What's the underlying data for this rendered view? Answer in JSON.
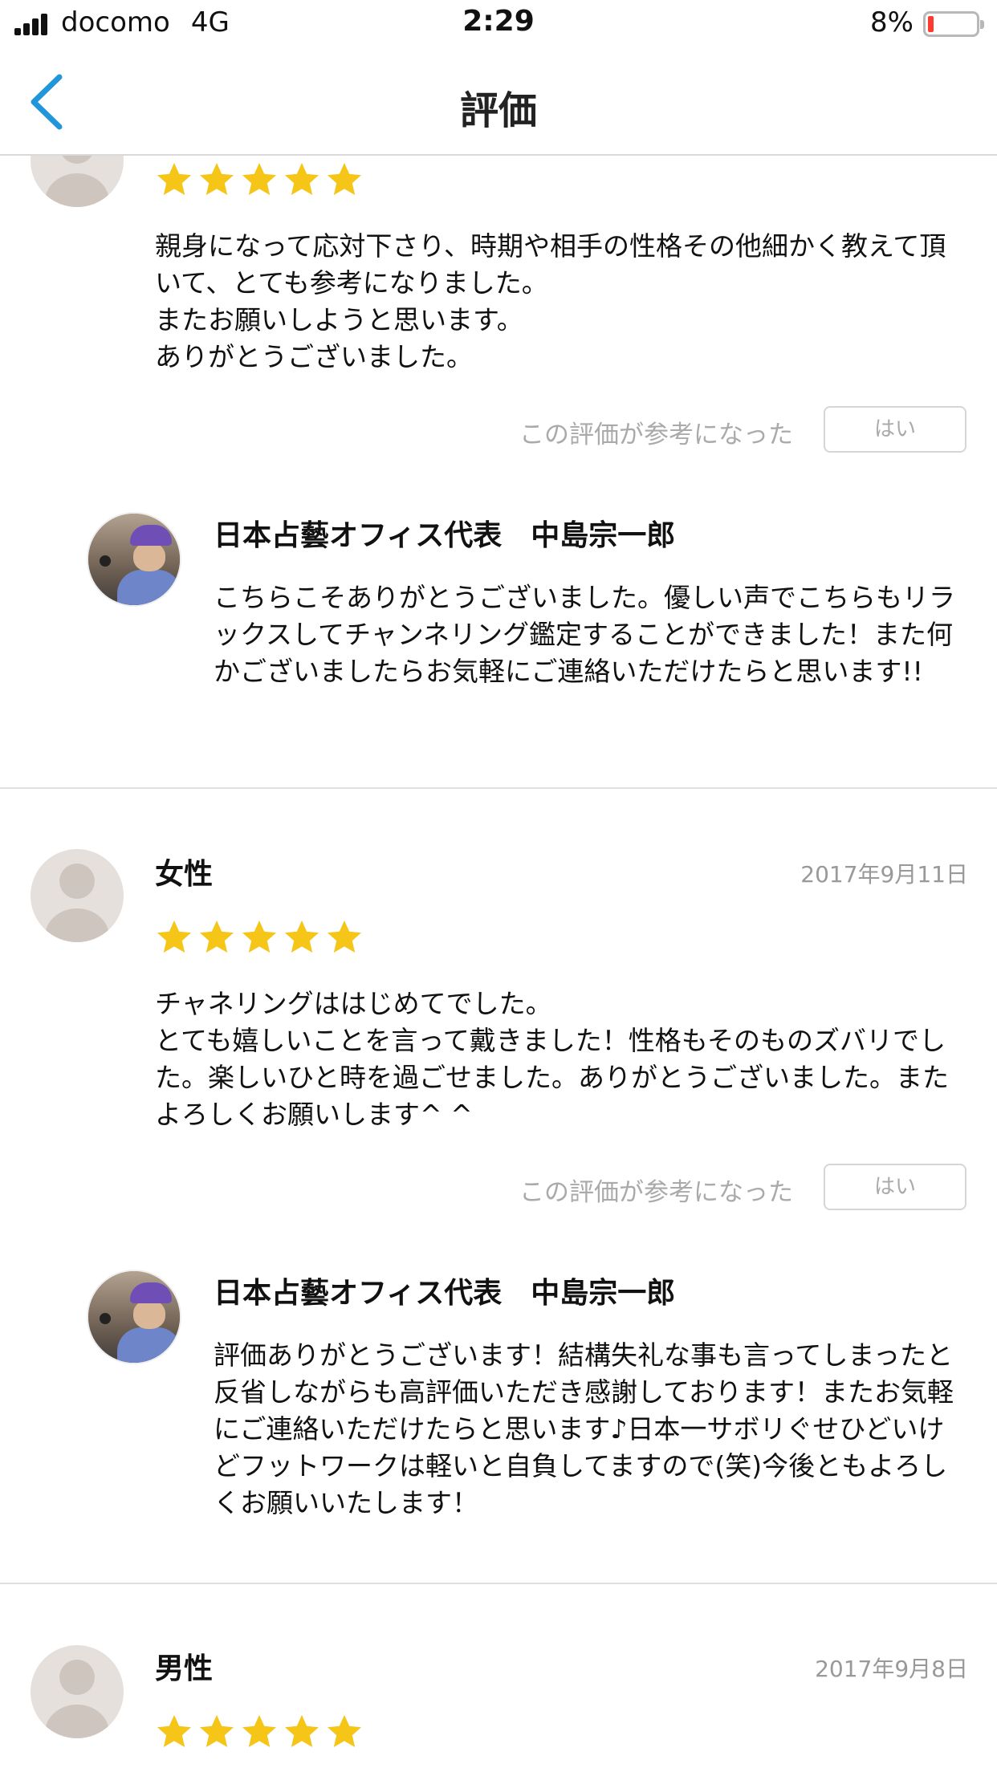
{
  "status_bar": {
    "carrier": "docomo",
    "network": "4G",
    "time": "2:29",
    "battery_percent": "8%",
    "battery_level": 0.08,
    "battery_color": "#ff3b30"
  },
  "nav": {
    "title": "評価",
    "back_icon": "chevron-left-icon",
    "accent": "#2196d8"
  },
  "star_color": "#f5c518",
  "reviews": [
    {
      "gender": "",
      "date": "",
      "rating": 5,
      "text": "親身になって応対下さり、時期や相手の性格その他細かく教えて頂いて、とても参考になりました。\nまたお願いしようと思います。\nありがとうございました。",
      "helpful_label": "この評価が参考になった",
      "helpful_button": "はい",
      "reply": {
        "name": "日本占藝オフィス代表　中島宗一郎",
        "text": "こちらこそありがとうございました。優しい声でこちらもリラックスしてチャンネリング鑑定することができました！また何かございましたらお気軽にご連絡いただけたらと思います!!"
      }
    },
    {
      "gender": "女性",
      "date": "2017年9月11日",
      "rating": 5,
      "text": "チャネリングははじめてでした。\nとても嬉しいことを言って戴きました！性格もそのものズバリでした。楽しいひと時を過ごせました。ありがとうございました。またよろしくお願いします^ ^",
      "helpful_label": "この評価が参考になった",
      "helpful_button": "はい",
      "reply": {
        "name": "日本占藝オフィス代表　中島宗一郎",
        "text": "評価ありがとうございます！結構失礼な事も言ってしまったと反省しながらも高評価いただき感謝しております！またお気軽にご連絡いただけたらと思います♪日本一サボリぐせひどいけどフットワークは軽いと自負してますので(笑)今後ともよろしくお願いいたします！"
      }
    },
    {
      "gender": "男性",
      "date": "2017年9月8日",
      "rating": 5
    }
  ]
}
